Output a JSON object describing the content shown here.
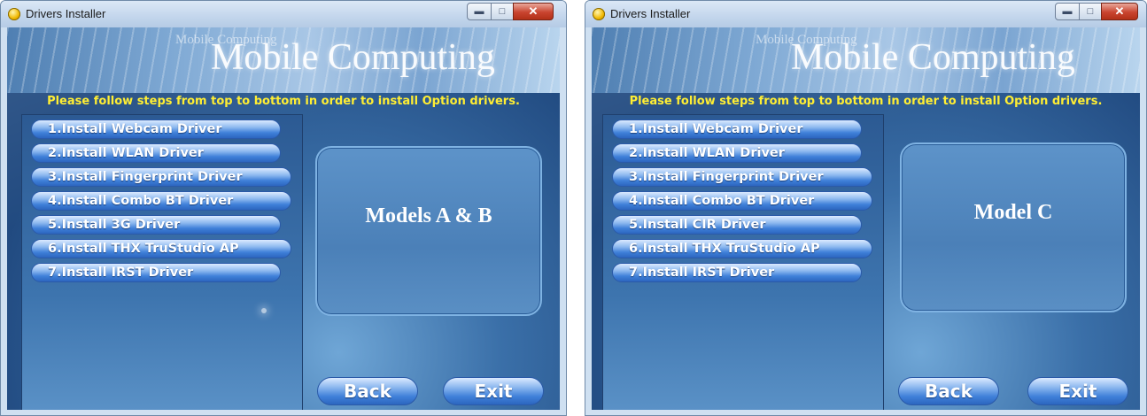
{
  "left_window": {
    "title": "Drivers Installer",
    "banner_small": "Mobile Computing",
    "banner_big": "Mobile Computing",
    "instruction": "Please follow steps from top to bottom in order to install Option drivers.",
    "buttons": [
      "1.Install Webcam Driver",
      "2.Install WLAN Driver",
      "3.Install Fingerprint Driver",
      "4.Install Combo BT Driver",
      "5.Install 3G Driver",
      "6.Install THX TruStudio AP",
      "7.Install IRST Driver"
    ],
    "model_label": "Models A & B",
    "back_label": "Back",
    "exit_label": "Exit"
  },
  "right_window": {
    "title": "Drivers Installer",
    "banner_small": "Mobile Computing",
    "banner_big": "Mobile Computing",
    "instruction": "Please follow steps from top to bottom in order to install Option drivers.",
    "buttons": [
      "1.Install Webcam Driver",
      "2.Install WLAN Driver",
      "3.Install Fingerprint Driver",
      "4.Install Combo BT Driver",
      "5.Install CIR Driver",
      "6.Install THX TruStudio AP",
      "7.Install IRST Driver"
    ],
    "model_label": "Model C",
    "back_label": "Back",
    "exit_label": "Exit"
  },
  "window_controls": {
    "minimize_icon": "minimize-icon",
    "maximize_icon": "maximize-icon",
    "close_icon": "close-icon"
  },
  "colors": {
    "instruction_text": "#ffee33",
    "button_blue": "#3f80d9",
    "close_red": "#c9442f"
  }
}
